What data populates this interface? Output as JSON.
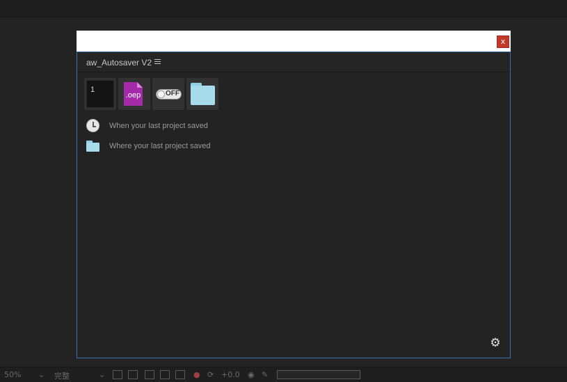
{
  "dialog": {
    "close_label": "x"
  },
  "panel": {
    "title": "aw_Autosaver V2",
    "menu_icon": "hamburger-menu-icon"
  },
  "tools": {
    "counter_value": "1",
    "oep_label": ".oep",
    "toggle_state": "OFF",
    "folder_icon": "folder-icon"
  },
  "info": {
    "last_saved_time": "When your last project saved",
    "last_saved_location": "Where your last project saved"
  },
  "settings_icon": "gear-icon",
  "bottom_bar": {
    "zoom": "50%",
    "quality": "完整",
    "exposure": "+0.0"
  },
  "colors": {
    "panel_border": "#3e6fb0",
    "close_button": "#c0392b",
    "oep_file": "#a52aa8",
    "folder": "#a6dbec"
  }
}
